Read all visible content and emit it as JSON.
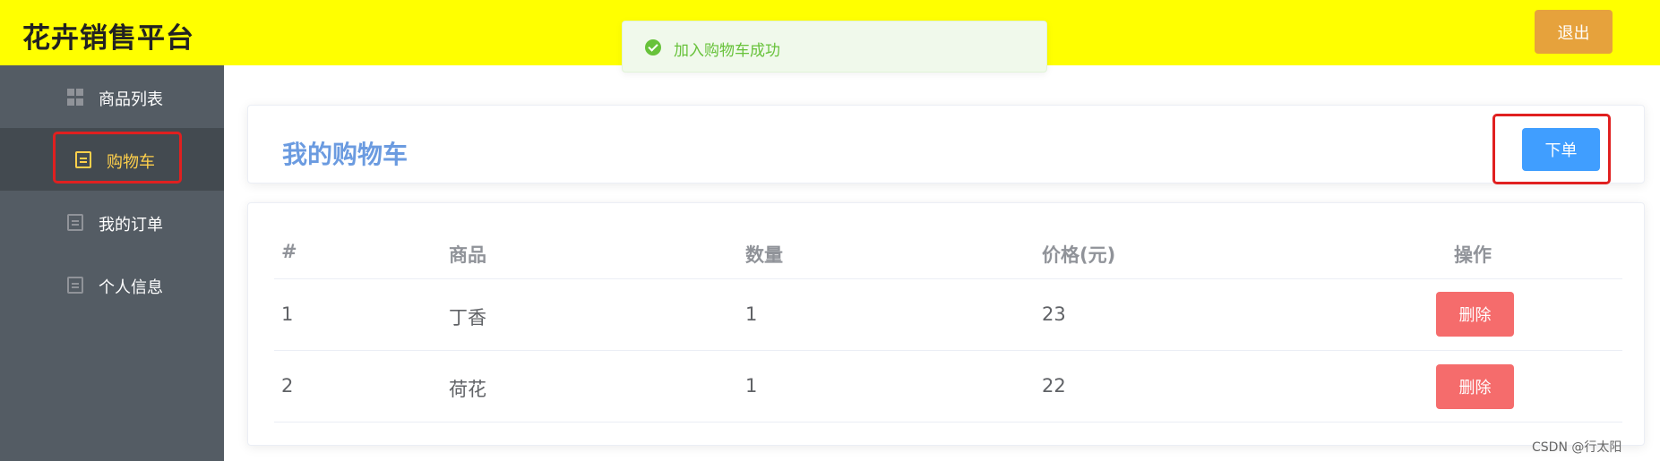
{
  "app": {
    "title": "花卉销售平台",
    "logout_label": "退出"
  },
  "toast": {
    "message": "加入购物车成功",
    "icon": "success-check-icon"
  },
  "sidebar": {
    "items": [
      {
        "label": "商品列表",
        "icon": "grid-icon",
        "active": false
      },
      {
        "label": "购物车",
        "icon": "document-icon",
        "active": true
      },
      {
        "label": "我的订单",
        "icon": "document-icon",
        "active": false
      },
      {
        "label": "个人信息",
        "icon": "document-icon",
        "active": false
      }
    ]
  },
  "cart": {
    "title": "我的购物车",
    "order_label": "下单"
  },
  "table": {
    "headers": [
      "#",
      "商品",
      "数量",
      "价格(元)",
      "操作"
    ],
    "rows": [
      {
        "index": "1",
        "product": "丁香",
        "quantity": "1",
        "price": "23",
        "action": "删除"
      },
      {
        "index": "2",
        "product": "荷花",
        "quantity": "1",
        "price": "22",
        "action": "删除"
      }
    ]
  },
  "watermark": "CSDN @行太阳",
  "colors": {
    "header_bg": "#ffff00",
    "sidebar_bg": "#545c64",
    "sidebar_active": "#ffd04b",
    "primary": "#409eff",
    "danger": "#f56c6c",
    "warning": "#e6a23c",
    "success": "#67c23a",
    "annotation": "#e02020"
  }
}
